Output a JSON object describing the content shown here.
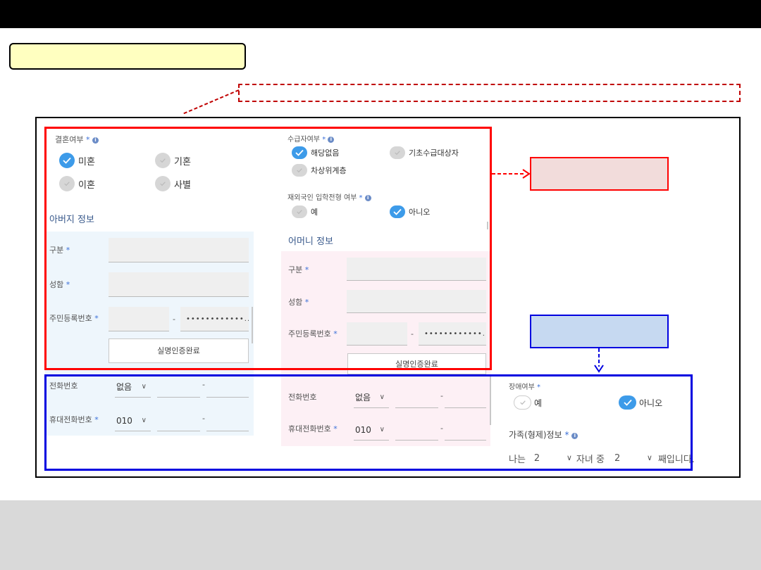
{
  "left_col": {
    "marriage": {
      "label": "결혼여부",
      "required": "*",
      "options": [
        {
          "label": "미혼",
          "selected": true
        },
        {
          "label": "기혼",
          "selected": false
        },
        {
          "label": "이혼",
          "selected": false
        },
        {
          "label": "사별",
          "selected": false
        }
      ]
    },
    "father": {
      "title": "아버지 정보",
      "gubun_label": "구분",
      "name_label": "성함",
      "rrn_label": "주민등록번호",
      "rrn_dash": "-",
      "rrn_masked": "••••••••••••...",
      "verify_button": "실명인증완료",
      "phone_label": "전화번호",
      "phone_prefix": "없음",
      "mobile_label": "휴대전화번호",
      "mobile_prefix": "010",
      "dash": "-",
      "required": "*"
    }
  },
  "right_col": {
    "recipient": {
      "label": "수급자여부",
      "required": "*",
      "options": [
        {
          "label": "해당없음",
          "selected": true
        },
        {
          "label": "기초수급대상자",
          "selected": false
        },
        {
          "label": "차상위계층",
          "selected": false
        }
      ]
    },
    "overseas": {
      "label": "재외국인 입학전형 여부",
      "required": "*",
      "options": [
        {
          "label": "예",
          "selected": false
        },
        {
          "label": "아니오",
          "selected": true
        }
      ]
    },
    "mother": {
      "title": "어머니 정보",
      "gubun_label": "구분",
      "name_label": "성함",
      "rrn_label": "주민등록번호",
      "rrn_dash": "-",
      "rrn_masked": "••••••••••••...",
      "verify_button": "실명인증완료",
      "phone_label": "전화번호",
      "phone_prefix": "없음",
      "mobile_label": "휴대전화번호",
      "mobile_prefix": "010",
      "dash": "-",
      "required": "*"
    }
  },
  "third_col": {
    "disability": {
      "label": "장애여부",
      "required": "*",
      "options": [
        {
          "label": "예",
          "selected": false
        },
        {
          "label": "아니오",
          "selected": true
        }
      ]
    },
    "family": {
      "label": "가족(형제)정보",
      "required": "*",
      "prefix": "나는",
      "total_value": "2",
      "middle": "자녀 중",
      "order_value": "2",
      "suffix": "째입니다."
    }
  },
  "icons": {
    "info": "i",
    "chevron": "∨"
  },
  "colors": {
    "accent_red": "#ff0000",
    "accent_blue": "#0000e0",
    "radio_selected": "#3d9be9"
  }
}
